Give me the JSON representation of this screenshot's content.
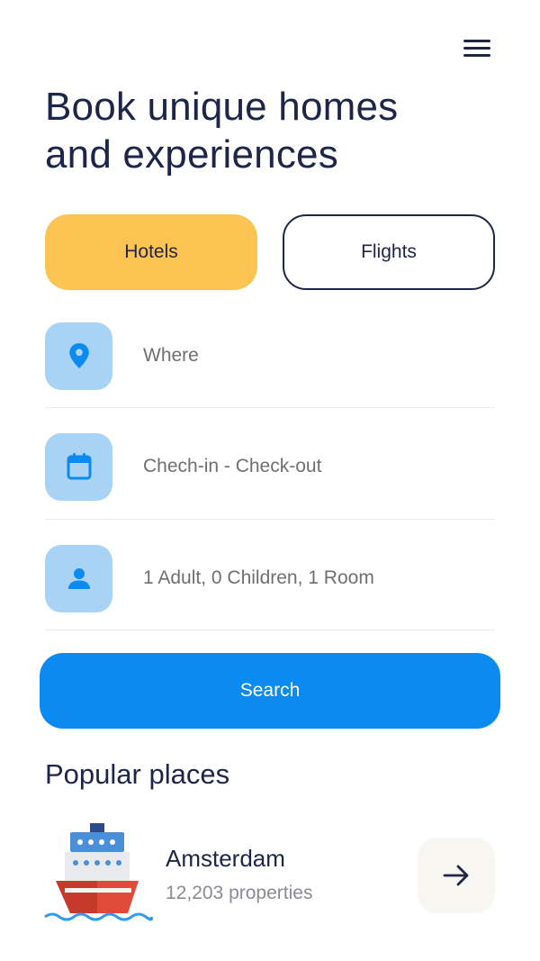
{
  "header": {
    "menu_icon": "hamburger-menu-icon",
    "headline": "Book unique homes and experiences"
  },
  "tabs": [
    {
      "label": "Hotels",
      "active": true
    },
    {
      "label": "Flights",
      "active": false
    }
  ],
  "fields": {
    "where": {
      "icon": "location-pin-icon",
      "placeholder": "Where"
    },
    "dates": {
      "icon": "calendar-icon",
      "placeholder": "Chech-in - Check-out"
    },
    "guests": {
      "icon": "person-icon",
      "value": "1 Adult, 0 Children, 1 Room"
    }
  },
  "search": {
    "label": "Search"
  },
  "popular": {
    "title": "Popular places",
    "items": [
      {
        "name": "Amsterdam",
        "count": "12,203 properties",
        "icon": "ship-icon",
        "action_icon": "arrow-right-icon"
      }
    ]
  },
  "colors": {
    "primary": "#0b8af0",
    "accent": "#fec453",
    "text_dark": "#1d2649",
    "icon_bg": "#a8d3f5",
    "muted_text": "#6f6f73"
  }
}
